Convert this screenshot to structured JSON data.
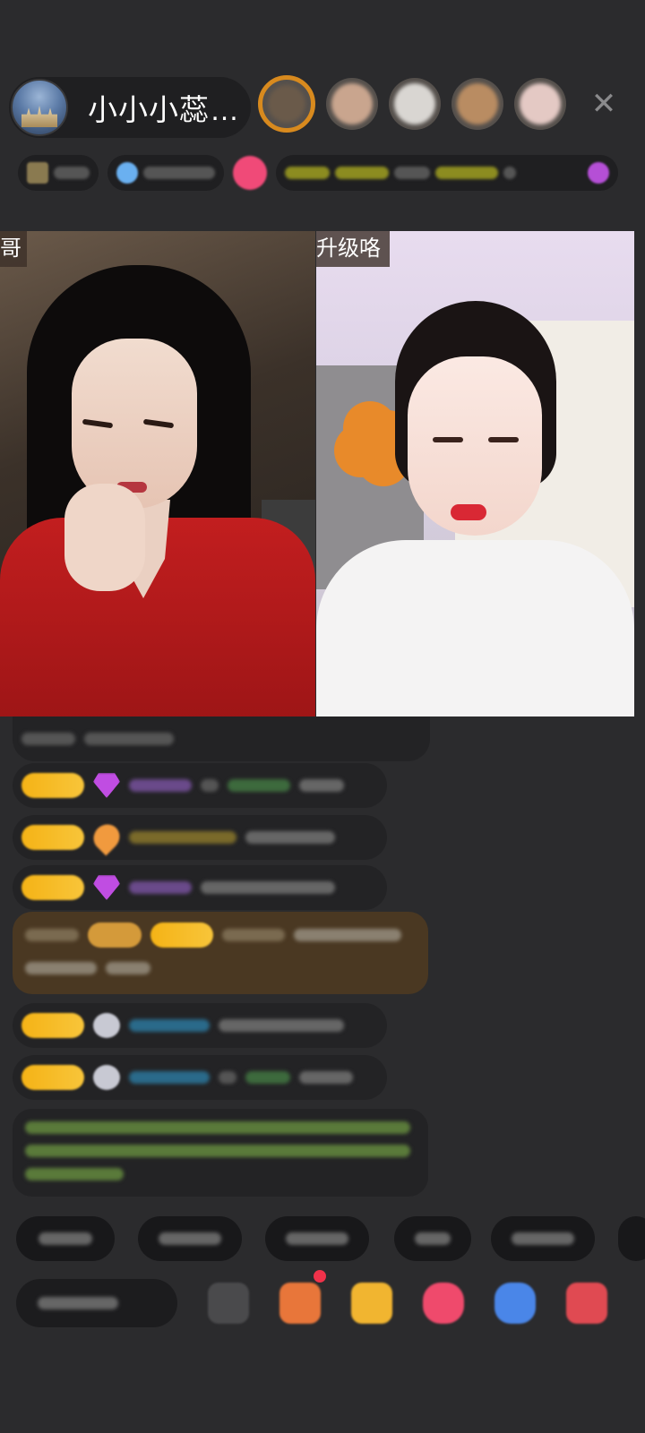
{
  "header": {
    "host_name": "小小小蕊…",
    "close_icon": "close-icon"
  },
  "videos": {
    "left_badge": "哥",
    "right_badge": "升级咯"
  },
  "colors": {
    "background": "#2b2b2d",
    "level_badge": "#f5b316",
    "gift_message_bg": "#4a3822",
    "notice_text": "#7fbf4a",
    "accent_pink": "#f04a78"
  }
}
